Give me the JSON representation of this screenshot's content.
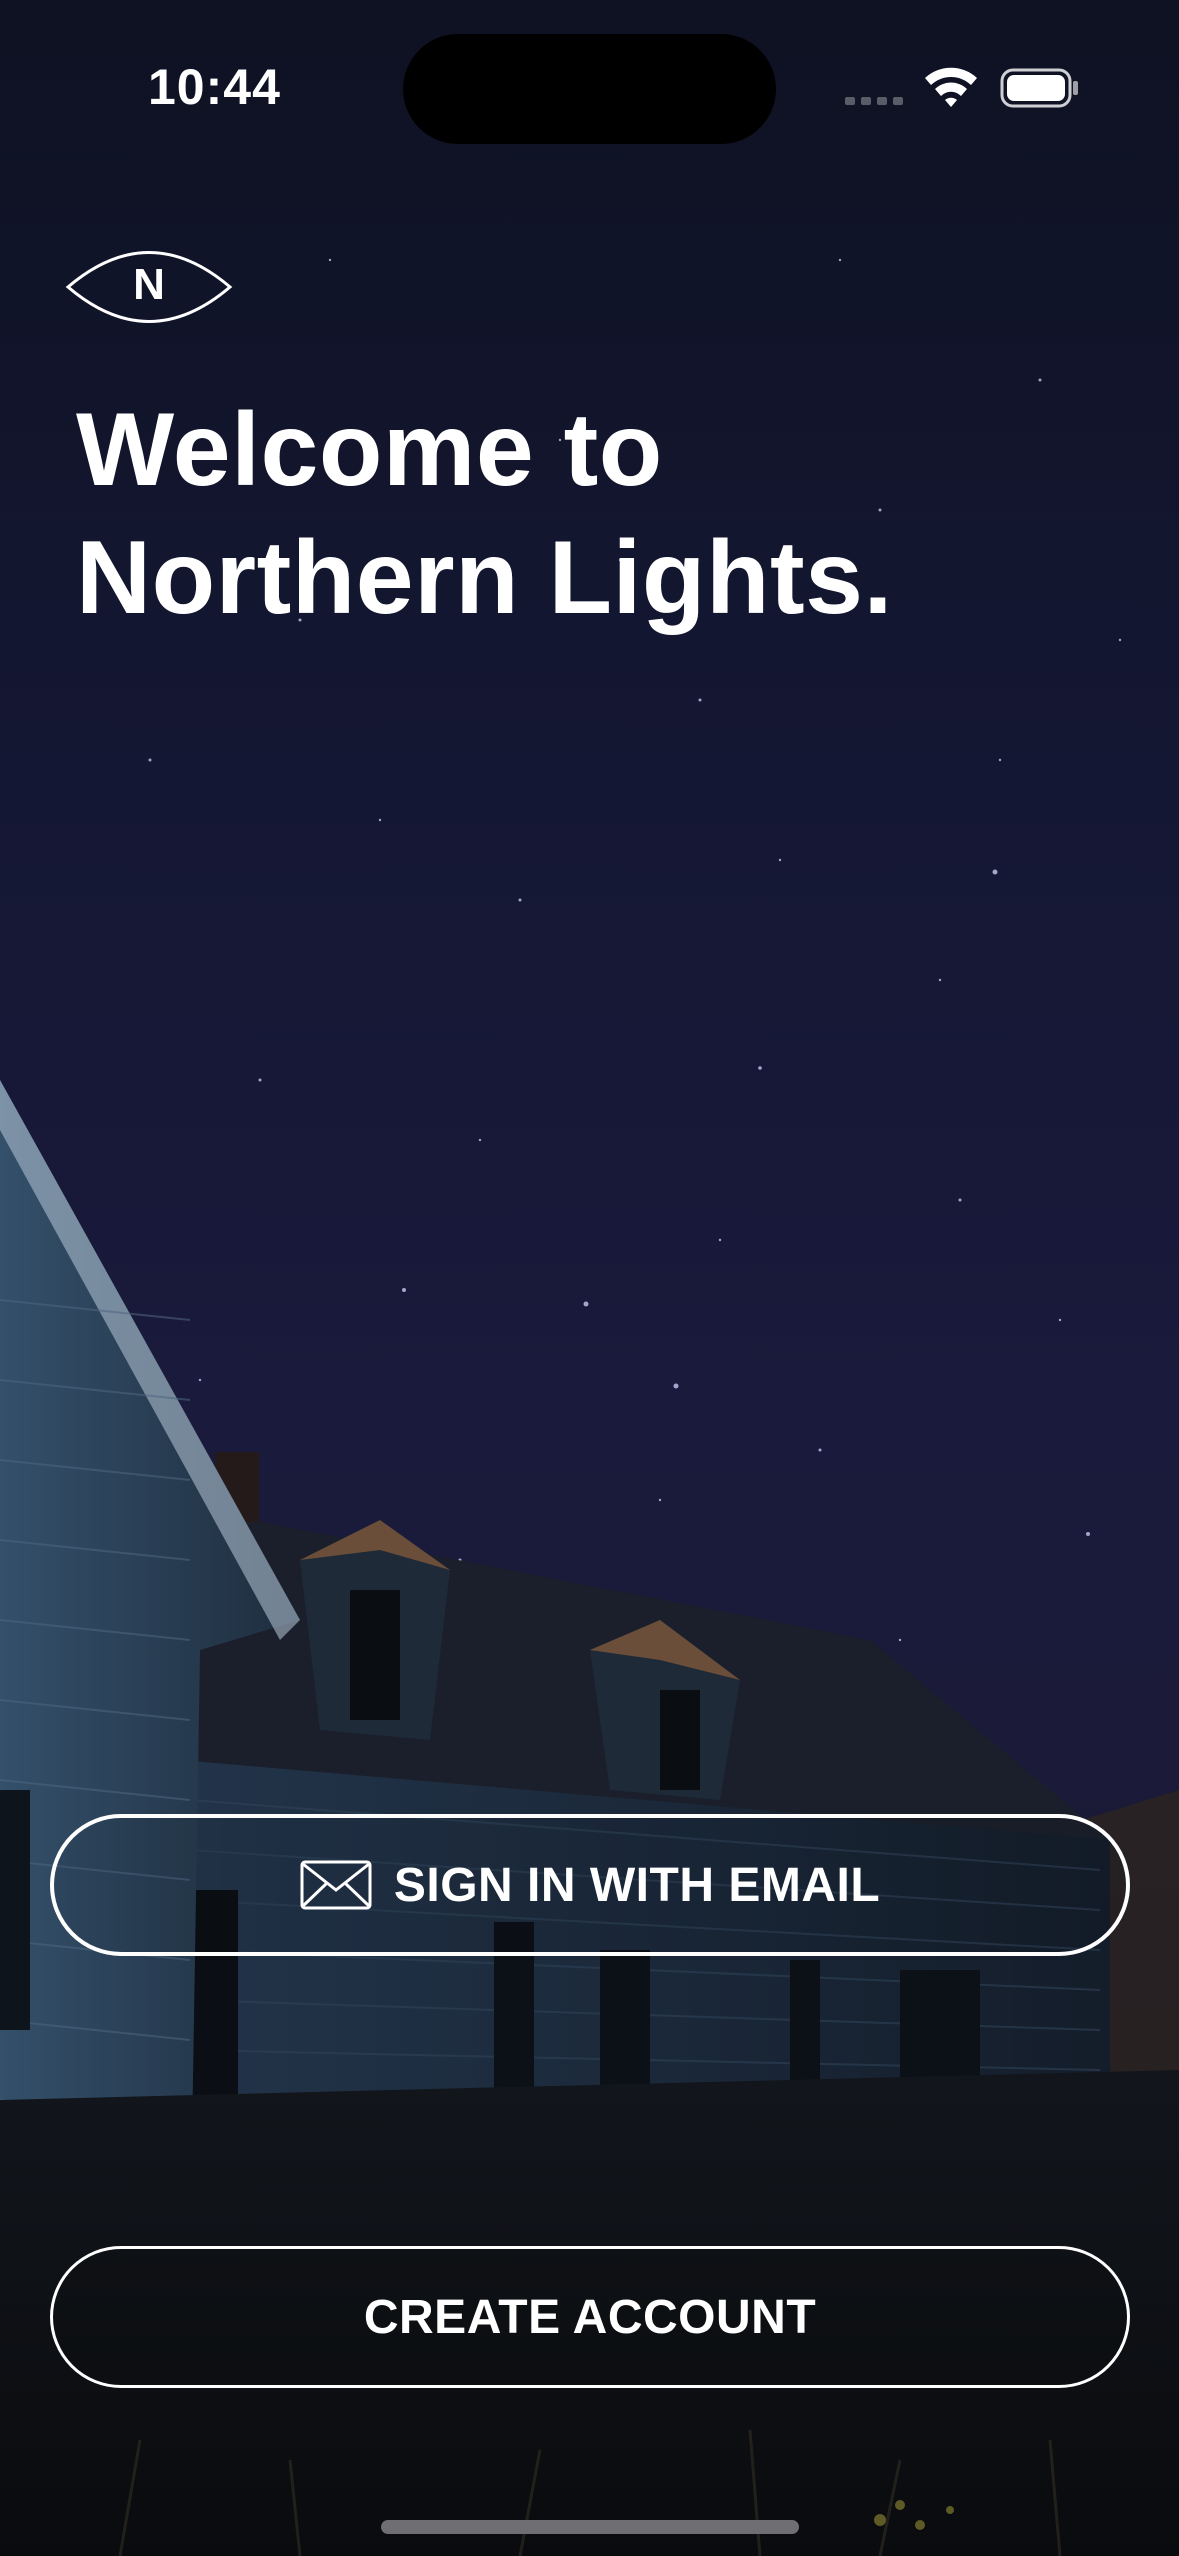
{
  "status_bar": {
    "time": "10:44"
  },
  "logo": {
    "letter": "N"
  },
  "welcome": {
    "line1": "Welcome to",
    "line2": "Northern Lights."
  },
  "buttons": {
    "sign_in_email": "SIGN IN WITH EMAIL",
    "create_account": "CREATE ACCOUNT"
  },
  "icons": {
    "mail": "mail-icon",
    "wifi": "wifi-icon",
    "battery": "battery-icon",
    "signal": "cellular-signal-icon"
  },
  "colors": {
    "text": "#ffffff",
    "button_border": "#ffffff",
    "sky_top": "#0e1222",
    "sky_mid": "#1a1a3c"
  }
}
